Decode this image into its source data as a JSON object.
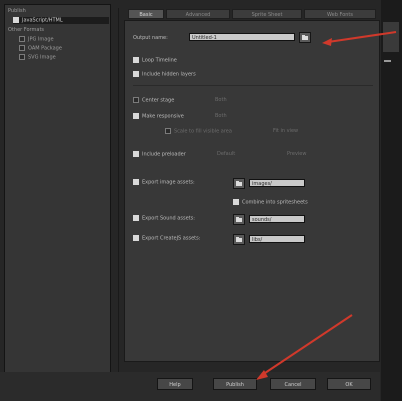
{
  "sidebar": {
    "items": [
      {
        "label": "Publish",
        "checked": false
      },
      {
        "label": "JavaScript/HTML",
        "checked": true
      },
      {
        "label": "Other Formats",
        "checked": false
      },
      {
        "label": "JPG Image",
        "checked": false
      },
      {
        "label": "OAM Package",
        "checked": false
      },
      {
        "label": "SVG Image",
        "checked": false
      }
    ]
  },
  "tabs": [
    "Basic",
    "Advanced",
    "Sprite Sheet",
    "Web Fonts"
  ],
  "basic": {
    "output_label": "Output name:",
    "output_value": "Untitled-1",
    "loop_label": "Loop Timeline",
    "hidden_label": "Include hidden layers",
    "center_label": "Center stage",
    "center_value": "Both",
    "responsive_label": "Make responsive",
    "responsive_value": "Both",
    "scale_label": "Scale to fill visible area",
    "scale_value": "Fit in view",
    "preloader_label": "Include preloader",
    "preloader_value": "Default",
    "preview_label": "Preview",
    "export_image_label": "Export image assets:",
    "export_image_value": "images/",
    "combine_label": "Combine into spritesheets",
    "export_sound_label": "Export Sound assets:",
    "export_sound_value": "sounds/",
    "export_createjs_label": "Export CreateJS assets:",
    "export_createjs_value": "libs/"
  },
  "footer": {
    "help": "Help",
    "publish": "Publish",
    "cancel": "Cancel",
    "ok": "OK"
  },
  "colors": {
    "annotation_arrow": "#d0392b",
    "panel": "#383838",
    "field": "#c9c9c9"
  }
}
